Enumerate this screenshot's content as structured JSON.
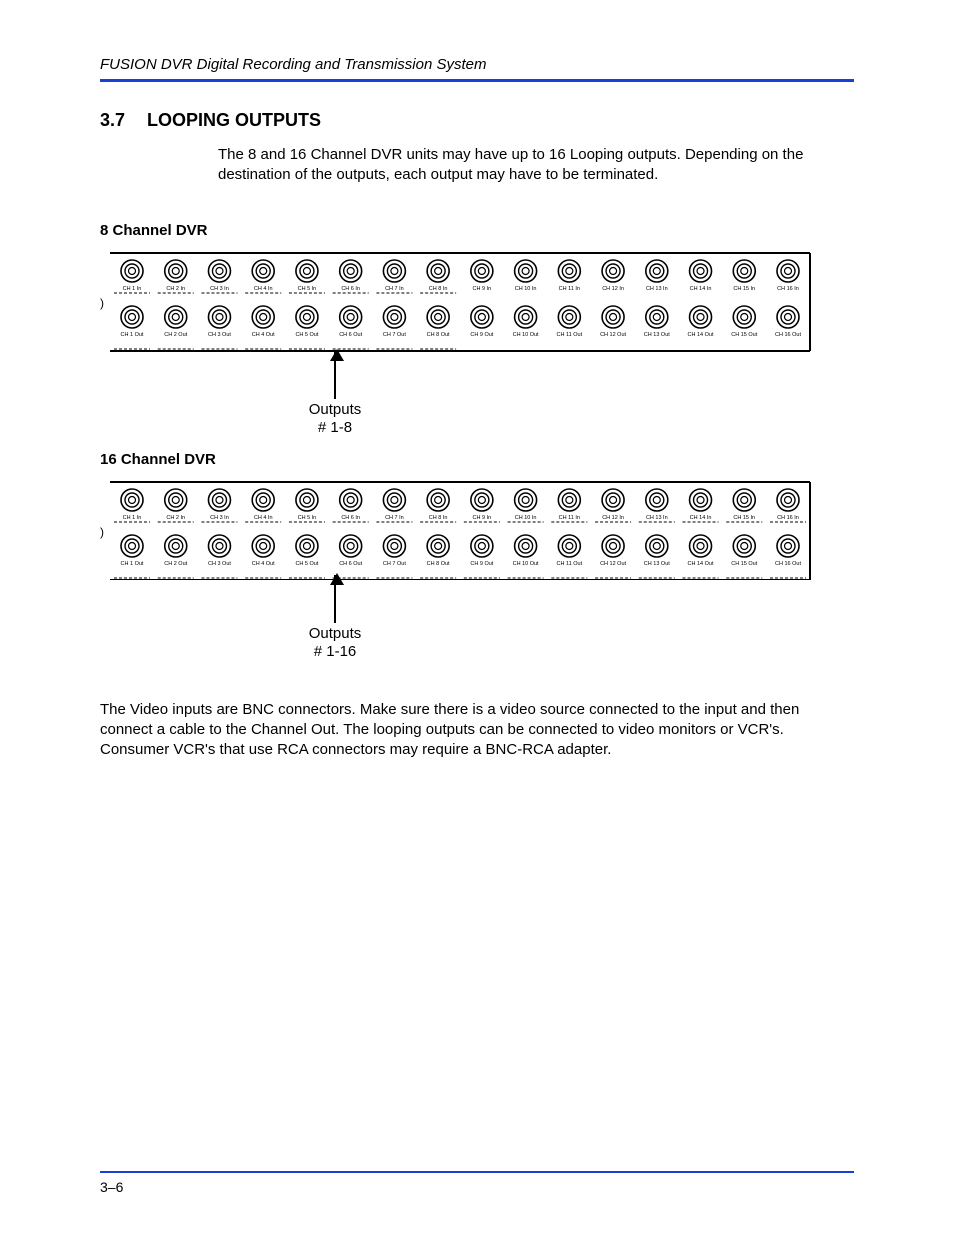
{
  "header": {
    "running": "FUSION DVR Digital Recording and Transmission System"
  },
  "section": {
    "number": "3.7",
    "title": "LOOPING OUTPUTS"
  },
  "intro": "The 8 and 16 Channel DVR units may have up to 16 Looping outputs. Depending on the destination of the outputs, each output may have to be terminated.",
  "panel8": {
    "title": "8 Channel DVR",
    "top_labels": [
      "CH 1 In",
      "CH 2 In",
      "CH 3 In",
      "CH 4 In",
      "CH 5 In",
      "CH 6 In",
      "CH 7 In",
      "CH 8 In",
      "CH 9 In",
      "CH 10 In",
      "CH 11 In",
      "CH 12 In",
      "CH 13 In",
      "CH 14 In",
      "CH 15 In",
      "CH 16 In"
    ],
    "bottom_labels": [
      "CH 1 Out",
      "CH 2 Out",
      "CH 3 Out",
      "CH 4 Out",
      "CH 5 Out",
      "CH 6 Out",
      "CH 7 Out",
      "CH 8 Out",
      "CH 9 Out",
      "CH 10 Out",
      "CH 11 Out",
      "CH 12 Out",
      "CH 13 Out",
      "CH 14 Out",
      "CH 15 Out",
      "CH 16 Out"
    ],
    "callout_line1": "Outputs",
    "callout_line2": "# 1-8",
    "dashed_active_count": 8
  },
  "panel16": {
    "title": "16 Channel DVR",
    "top_labels": [
      "CH 1 In",
      "CH 2 In",
      "CH 3 In",
      "CH 4 In",
      "CH 5 In",
      "CH 6 In",
      "CH 7 In",
      "CH 8 In",
      "CH 9 In",
      "CH 10 In",
      "CH 11 In",
      "CH 12 In",
      "CH 13 In",
      "CH 14 In",
      "CH 15 In",
      "CH 16 In"
    ],
    "bottom_labels": [
      "CH 1 Out",
      "CH 2 Out",
      "CH 3 Out",
      "CH 4 Out",
      "CH 5 Out",
      "CH 6 Out",
      "CH 7 Out",
      "CH 8 Out",
      "CH 9 Out",
      "CH 10 Out",
      "CH 11 Out",
      "CH 12 Out",
      "CH 13 Out",
      "CH 14 Out",
      "CH 15 Out",
      "CH 16 Out"
    ],
    "callout_line1": "Outputs",
    "callout_line2": "# 1-16",
    "dashed_active_count": 16
  },
  "body": "The Video inputs are BNC connectors. Make sure there is a video source connected to the input and then connect a cable to the Channel Out. The looping outputs can be connected to video monitors or VCR's. Consumer VCR's that use RCA connectors may require a BNC-RCA adapter.",
  "footer": {
    "page": "3–6"
  }
}
